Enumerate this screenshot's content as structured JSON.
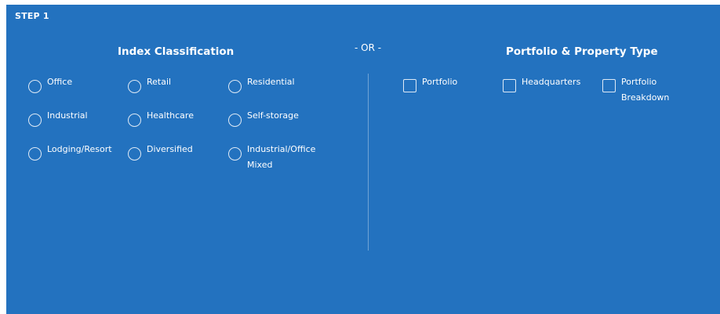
{
  "step": {
    "label": "STEP 1"
  },
  "index_classification": {
    "title": "Index Classification",
    "options": [
      "Office",
      "Retail",
      "Residential",
      "Industrial",
      "Healthcare",
      "Self-storage",
      "Lodging/Resort",
      "Diversified",
      "Industrial/Office"
    ],
    "option_extra_line": "Mixed"
  },
  "separator": {
    "label": "- OR -"
  },
  "portfolio_property_type": {
    "title": "Portfolio & Property Type",
    "options": [
      "Portfolio",
      "Headquarters",
      "Portfolio"
    ],
    "option_extra_line": "Breakdown"
  },
  "colors": {
    "panel_background": "#2372bf",
    "text": "#ffffff"
  }
}
